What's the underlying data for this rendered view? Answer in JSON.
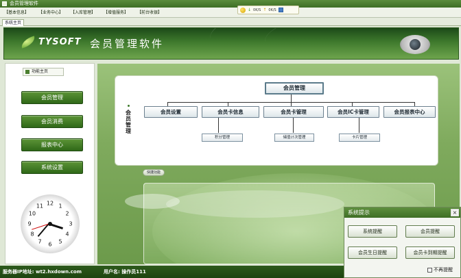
{
  "window": {
    "title": "会员管理软件"
  },
  "menu": [
    "【基本信息】",
    "【业务中心】",
    "【入库管理】",
    "【增值服务】",
    "【前台收银】"
  ],
  "net_meter": {
    "down": "0K/S",
    "up": "0K/S"
  },
  "tabs": [
    "系统主页"
  ],
  "header": {
    "logo_text": "TYSOFT",
    "app_name": "会员管理软件"
  },
  "sidebar": {
    "title": "功能主页",
    "buttons": [
      "会员管理",
      "会员消费",
      "报表中心",
      "系统设置"
    ]
  },
  "clock": {
    "numbers": [
      "12",
      "1",
      "2",
      "3",
      "4",
      "5",
      "6",
      "7",
      "8",
      "9",
      "10",
      "11"
    ],
    "time": "3:36:42"
  },
  "diagram": {
    "section_label": "会员管理",
    "root": "会员管理",
    "children": [
      "会员设置",
      "会员卡信息",
      "会员卡管理",
      "会员IC卡管理",
      "会员报表中心"
    ],
    "leaves": [
      "积分管理",
      "储值计次管理",
      "卡片管理"
    ]
  },
  "quick_tag": "快捷功能",
  "status_bar": {
    "server": "服务器IP地址: wt2.hxdown.com",
    "user": "用户名: 操作员111"
  },
  "popup": {
    "title": "系统提示",
    "close": "×",
    "buttons": [
      "系统提醒",
      "会员提醒",
      "会员生日提醒",
      "会员卡到期提醒"
    ],
    "checkbox_label": "不再提醒",
    "checkbox_checked": false
  },
  "colors": {
    "theme_green": "#3f7a2d",
    "accent_light": "#9bc27a"
  }
}
